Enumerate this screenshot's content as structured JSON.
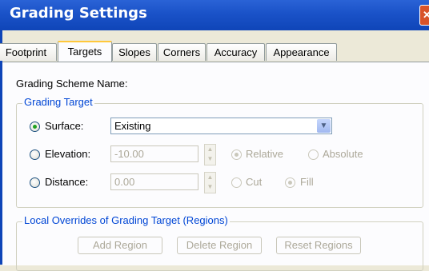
{
  "window": {
    "title": "Grading Settings",
    "close_glyph": "✕"
  },
  "tabs": [
    {
      "label": "Footprint"
    },
    {
      "label": "Targets"
    },
    {
      "label": "Slopes"
    },
    {
      "label": "Corners"
    },
    {
      "label": "Accuracy"
    },
    {
      "label": "Appearance"
    }
  ],
  "scheme_name_label": "Grading Scheme Name:",
  "grading_target": {
    "title": "Grading Target",
    "surface": {
      "label": "Surface:",
      "checked": true,
      "value": "Existing"
    },
    "elevation": {
      "label": "Elevation:",
      "checked": false,
      "value": "-10.00",
      "relative_label": "Relative",
      "absolute_label": "Absolute"
    },
    "distance": {
      "label": "Distance:",
      "checked": false,
      "value": "0.00",
      "cut_label": "Cut",
      "fill_label": "Fill"
    }
  },
  "overrides": {
    "title": "Local Overrides of Grading Target (Regions)",
    "add_label": "Add Region",
    "delete_label": "Delete Region",
    "reset_label": "Reset Regions"
  },
  "colors": {
    "title_bar": "#1a52c8",
    "group_title": "#0046d5",
    "radio_check": "#21a121",
    "tab_highlight": "#ffc83c"
  },
  "icons": {
    "dropdown": "chevron-down-icon",
    "close": "close-icon"
  }
}
